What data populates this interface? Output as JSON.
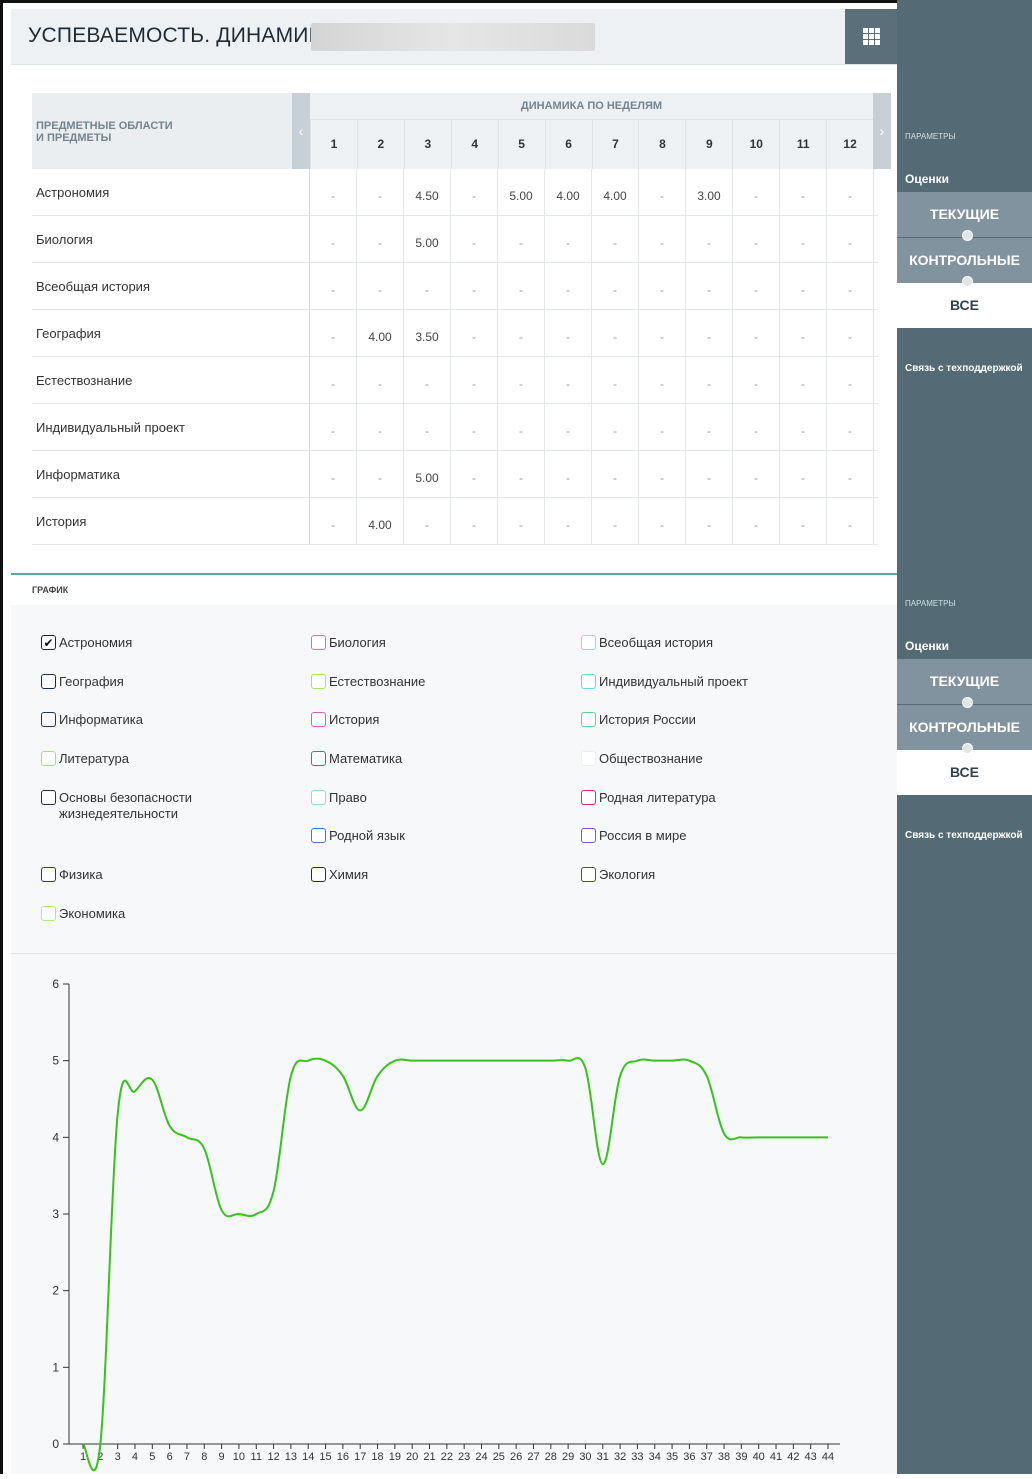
{
  "header": {
    "title": "УСПЕВАЕМОСТЬ. ДИНАМИКА.",
    "apps_icon": "grid-icon"
  },
  "table": {
    "subjects_header_line1": "ПРЕДМЕТНЫЕ ОБЛАСТИ",
    "subjects_header_line2": "И ПРЕДМЕТЫ",
    "dynamics_header": "ДИНАМИКА ПО НЕДЕЛЯМ",
    "weeks": [
      "1",
      "2",
      "3",
      "4",
      "5",
      "6",
      "7",
      "8",
      "9",
      "10",
      "11",
      "12"
    ],
    "rows": [
      {
        "subject": "Астрономия",
        "values": [
          "-",
          "-",
          "4.50",
          "-",
          "5.00",
          "4.00",
          "4.00",
          "-",
          "3.00",
          "-",
          "-",
          "-"
        ]
      },
      {
        "subject": "Биология",
        "values": [
          "-",
          "-",
          "5.00",
          "-",
          "-",
          "-",
          "-",
          "-",
          "-",
          "-",
          "-",
          "-"
        ]
      },
      {
        "subject": "Всеобщая история",
        "values": [
          "-",
          "-",
          "-",
          "-",
          "-",
          "-",
          "-",
          "-",
          "-",
          "-",
          "-",
          "-"
        ]
      },
      {
        "subject": "География",
        "values": [
          "-",
          "4.00",
          "3.50",
          "-",
          "-",
          "-",
          "-",
          "-",
          "-",
          "-",
          "-",
          "-"
        ]
      },
      {
        "subject": "Естествознание",
        "values": [
          "-",
          "-",
          "-",
          "-",
          "-",
          "-",
          "-",
          "-",
          "-",
          "-",
          "-",
          "-"
        ]
      },
      {
        "subject": "Индивидуальный проект",
        "values": [
          "-",
          "-",
          "-",
          "-",
          "-",
          "-",
          "-",
          "-",
          "-",
          "-",
          "-",
          "-"
        ]
      },
      {
        "subject": "Информатика",
        "values": [
          "-",
          "-",
          "5.00",
          "-",
          "-",
          "-",
          "-",
          "-",
          "-",
          "-",
          "-",
          "-"
        ]
      },
      {
        "subject": "История",
        "values": [
          "-",
          "4.00",
          "-",
          "-",
          "-",
          "-",
          "-",
          "-",
          "-",
          "-",
          "-",
          "-"
        ]
      }
    ]
  },
  "graph": {
    "label": "ГРАФИК",
    "legend": [
      {
        "name": "Астрономия",
        "color": "#222222",
        "checked": true
      },
      {
        "name": "Биология",
        "color": "#c479c0",
        "checked": false
      },
      {
        "name": "Всеобщая история",
        "color": "#9ed3e3",
        "checked": false
      },
      {
        "name": "География",
        "color": "#1a2b4a",
        "checked": false
      },
      {
        "name": "Естествознание",
        "color": "#a7e36b",
        "checked": false
      },
      {
        "name": "Индивидуальный проект",
        "color": "#6fd3e0",
        "checked": false
      },
      {
        "name": "Информатика",
        "color": "#23306b",
        "checked": false
      },
      {
        "name": "История",
        "color": "#d45fc8",
        "checked": false
      },
      {
        "name": "История России",
        "color": "#5fcf92",
        "checked": false
      },
      {
        "name": "Литература",
        "color": "#a6dc8f",
        "checked": false
      },
      {
        "name": "Математика",
        "color": "#2f8f70",
        "checked": false
      },
      {
        "name": "Обществознание",
        "color": "#eeeeee",
        "checked": false
      },
      {
        "name": "Основы безопасности жизнедеятельности",
        "color": "#223055",
        "checked": false
      },
      {
        "name": "Право",
        "color": "#8fdcc0",
        "checked": false
      },
      {
        "name": "Родная литература",
        "color": "#d8287a",
        "checked": false
      },
      {
        "name": "Родной язык",
        "color": "#3c7bc2",
        "checked": false
      },
      {
        "name": "Россия в мире",
        "color": "#7d56c7",
        "checked": false
      },
      {
        "name": "Физика",
        "color": "#3a2a8a",
        "checked": false
      },
      {
        "name": "Химия",
        "color": "#2a1f6e",
        "checked": false
      },
      {
        "name": "Экология",
        "color": "#4a5a28",
        "checked": false
      },
      {
        "name": "Экономика",
        "color": "#a6f07a",
        "checked": false
      }
    ]
  },
  "chart_data": {
    "type": "line",
    "title": "",
    "xlabel": "",
    "ylabel": "",
    "ylim": [
      0,
      6
    ],
    "yticks": [
      0,
      1,
      2,
      3,
      4,
      5,
      6
    ],
    "x": [
      1,
      2,
      3,
      4,
      5,
      6,
      7,
      8,
      9,
      10,
      11,
      12,
      13,
      14,
      15,
      16,
      17,
      18,
      19,
      20,
      21,
      22,
      23,
      24,
      25,
      26,
      27,
      28,
      29,
      30,
      31,
      32,
      33,
      34,
      35,
      36,
      37,
      38,
      39,
      40,
      41,
      42,
      43,
      44
    ],
    "series": [
      {
        "name": "Астрономия",
        "color": "#37c21c",
        "values": [
          0,
          0,
          4.3,
          4.6,
          4.75,
          4.15,
          4.0,
          3.85,
          3.05,
          3.0,
          3.0,
          3.3,
          4.8,
          5.0,
          5.0,
          4.8,
          4.35,
          4.8,
          5.0,
          5.0,
          5.0,
          5.0,
          5.0,
          5.0,
          5.0,
          5.0,
          5.0,
          5.0,
          5.0,
          4.9,
          3.65,
          4.8,
          5.0,
          5.0,
          5.0,
          5.0,
          4.8,
          4.05,
          4.0,
          4.0,
          4.0,
          4.0,
          4.0,
          4.0
        ]
      }
    ],
    "grid": false,
    "legend": "none"
  },
  "sidebar": {
    "blocks": [
      {
        "params": "ПАРАМЕТРЫ",
        "grades": "Оценки",
        "current": "ТЕКУЩИЕ",
        "control": "КОНТРОЛЬНЫЕ",
        "all": "ВСЕ",
        "support": "Связь с техподдержкой"
      },
      {
        "params": "ПАРАМЕТРЫ",
        "grades": "Оценки",
        "current": "ТЕКУЩИЕ",
        "control": "КОНТРОЛЬНЫЕ",
        "all": "ВСЕ",
        "support": "Связь с техподдержкой"
      }
    ]
  }
}
